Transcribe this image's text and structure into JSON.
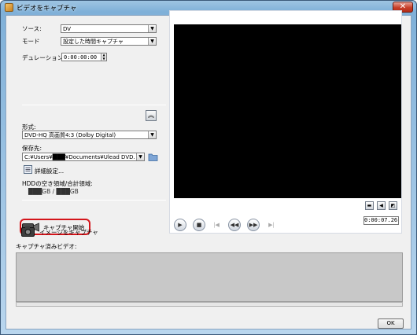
{
  "window": {
    "title": "ビデオをキャプチャ",
    "close_glyph": "✕"
  },
  "source": {
    "label": "ソース:",
    "value": "DV"
  },
  "mode": {
    "label": "モード",
    "value": "設定した時間キャプチャ"
  },
  "duration": {
    "label": "デュレーション:",
    "value": "0:00:00:00"
  },
  "collapse_glyph": "︽",
  "format": {
    "label": "形式:",
    "value": "DVD-HQ 高画質4:3 (Dolby Digital)"
  },
  "save_to": {
    "label": "保存先:",
    "value": "C:¥Users¥███¥Documents¥Ulead DVD..."
  },
  "detail_settings": "詳細設定...",
  "hdd": {
    "label": "HDDの空き領域/合計領域:",
    "value": "███GB / ███GB"
  },
  "capture_start": "キャプチャ開始",
  "capture_image": "イメージをキャプチャ",
  "captured_videos_label": "キャプチャ済みビデオ:",
  "timecode": "0:00:07.26",
  "ok_label": "OK"
}
